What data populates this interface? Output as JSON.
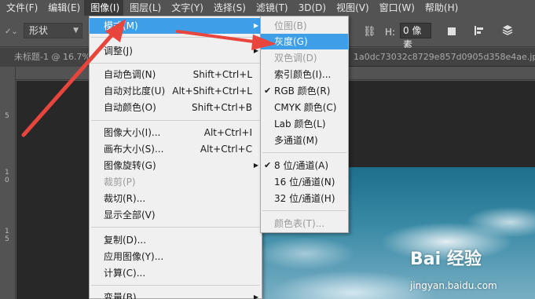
{
  "menubar": {
    "items": [
      "文件(F)",
      "编辑(E)",
      "图像(I)",
      "图层(L)",
      "文字(Y)",
      "选择(S)",
      "滤镜(T)",
      "3D(D)",
      "视图(V)",
      "窗口(W)",
      "帮助(H)"
    ],
    "active_index": 2
  },
  "options_bar": {
    "shape_mode": "形状",
    "h_label": "H:",
    "h_value": "0 像素"
  },
  "tabs": {
    "doc_title": "未标题-1 @ 16.7%",
    "right_title": "1a0dc73032c8729e857d0905d358e4ae.jpg"
  },
  "rulers": {
    "vertical_ticks": [
      "5",
      "1\n0",
      "1\n5"
    ]
  },
  "image_menu": {
    "items": [
      {
        "label": "模式(M)",
        "shortcut": "",
        "submenu": true,
        "highlighted": true
      },
      {
        "label": "调整(J)",
        "shortcut": "",
        "submenu": true
      },
      {
        "label": "自动色调(N)",
        "shortcut": "Shift+Ctrl+L"
      },
      {
        "label": "自动对比度(U)",
        "shortcut": "Alt+Shift+Ctrl+L"
      },
      {
        "label": "自动颜色(O)",
        "shortcut": "Shift+Ctrl+B"
      },
      {
        "label": "图像大小(I)...",
        "shortcut": "Alt+Ctrl+I"
      },
      {
        "label": "画布大小(S)...",
        "shortcut": "Alt+Ctrl+C"
      },
      {
        "label": "图像旋转(G)",
        "shortcut": "",
        "submenu": true
      },
      {
        "label": "裁剪(P)",
        "shortcut": "",
        "disabled": true
      },
      {
        "label": "裁切(R)...",
        "shortcut": ""
      },
      {
        "label": "显示全部(V)",
        "shortcut": ""
      },
      {
        "label": "复制(D)...",
        "shortcut": ""
      },
      {
        "label": "应用图像(Y)...",
        "shortcut": ""
      },
      {
        "label": "计算(C)...",
        "shortcut": ""
      },
      {
        "label": "变量(B)",
        "shortcut": "",
        "submenu": true
      }
    ]
  },
  "mode_submenu": {
    "items": [
      {
        "label": "位图(B)",
        "disabled": true
      },
      {
        "label": "灰度(G)",
        "highlighted": true
      },
      {
        "label": "双色调(D)",
        "disabled": true
      },
      {
        "label": "索引颜色(I)..."
      },
      {
        "label": "RGB 颜色(R)",
        "checked": true
      },
      {
        "label": "CMYK 颜色(C)"
      },
      {
        "label": "Lab 颜色(L)"
      },
      {
        "label": "多通道(M)"
      },
      {
        "label": "8 位/通道(A)",
        "checked": true
      },
      {
        "label": "16 位/通道(N)"
      },
      {
        "label": "32 位/通道(H)"
      },
      {
        "label": "颜色表(T)...",
        "disabled": true
      }
    ]
  },
  "watermark": {
    "logo_text": "Bai 经验",
    "url": "jingyan.baidu.com"
  },
  "colors": {
    "highlight": "#3f9ee8",
    "annotation_arrow": "#e8453c",
    "menu_background": "#f0f0f0",
    "app_background": "#535353"
  }
}
